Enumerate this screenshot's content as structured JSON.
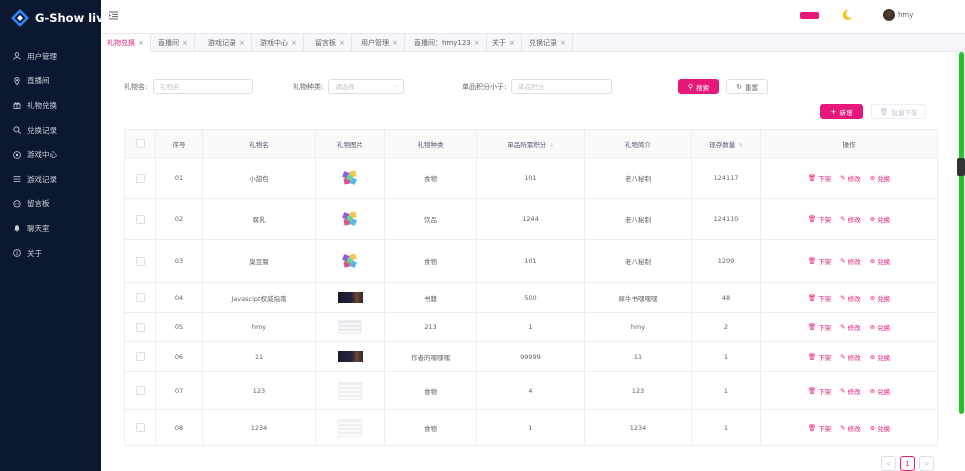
{
  "app": {
    "name": "G-Show live"
  },
  "sidebar": {
    "items": [
      {
        "label": "用户管理",
        "icon": "user-icon"
      },
      {
        "label": "直播间",
        "icon": "location-icon"
      },
      {
        "label": "礼物兑换",
        "icon": "gift-icon"
      },
      {
        "label": "兑换记录",
        "icon": "search-icon"
      },
      {
        "label": "游戏中心",
        "icon": "game-icon"
      },
      {
        "label": "游戏记录",
        "icon": "list-icon"
      },
      {
        "label": "留言板",
        "icon": "message-icon"
      },
      {
        "label": "聊天室",
        "icon": "bell-icon"
      },
      {
        "label": "关于",
        "icon": "info-icon"
      }
    ]
  },
  "header": {
    "user": "hmy",
    "accent": "#e6197a"
  },
  "tabs": [
    {
      "label": "礼物兑换",
      "active": true
    },
    {
      "label": "直播间"
    },
    {
      "label": "游戏记录"
    },
    {
      "label": "游戏中心"
    },
    {
      "label": "留言板"
    },
    {
      "label": "用户管理"
    },
    {
      "label": "直播间：hmy123"
    },
    {
      "label": "关于"
    },
    {
      "label": "兑换记录"
    }
  ],
  "search": {
    "gift_name_label": "礼物名:",
    "gift_name_placeholder": "礼物名",
    "gift_type_label": "礼物种类:",
    "gift_type_placeholder": "请选择",
    "points_label": "单品积分小于:",
    "points_placeholder": "单品积分",
    "search_btn": "搜索",
    "reset_btn": "重置"
  },
  "actions": {
    "add_btn": "新增",
    "batch_remove_btn": "批量下架"
  },
  "table": {
    "headers": {
      "index": "序号",
      "name": "礼物名",
      "image": "礼物图片",
      "type": "礼物种类",
      "points": "单品所需积分",
      "desc": "礼物简介",
      "stock": "现存数量",
      "ops": "操作"
    },
    "op_labels": {
      "remove": "下架",
      "edit": "修改",
      "exchange": "兑换"
    },
    "rows": [
      {
        "index": "01",
        "name": "小甜包",
        "image": "candy",
        "type": "食物",
        "points": "101",
        "desc": "老八秘制",
        "stock": "124117"
      },
      {
        "index": "02",
        "name": "腐乳",
        "image": "candy",
        "type": "饮品",
        "points": "1244",
        "desc": "老八秘制",
        "stock": "124110"
      },
      {
        "index": "03",
        "name": "臭豆腐",
        "image": "candy",
        "type": "食物",
        "points": "101",
        "desc": "老八秘制",
        "stock": "1209"
      },
      {
        "index": "04",
        "name": "Javascipt权威指南",
        "image": "dark",
        "type": "书籍",
        "points": "500",
        "desc": "犀牛书嘿嘿嘿",
        "stock": "48"
      },
      {
        "index": "05",
        "name": "hmy",
        "image": "doc",
        "type": "213",
        "points": "1",
        "desc": "hmy",
        "stock": "2"
      },
      {
        "index": "06",
        "name": "11",
        "image": "dark",
        "type": "作者的嘿嘿嘿",
        "points": "99999",
        "desc": "11",
        "stock": "1"
      },
      {
        "index": "07",
        "name": "123",
        "image": "sheet",
        "type": "食物",
        "points": "4",
        "desc": "123",
        "stock": "1"
      },
      {
        "index": "08",
        "name": "1234",
        "image": "sheet",
        "type": "食物",
        "points": "1",
        "desc": "1234",
        "stock": "1"
      }
    ]
  },
  "pagination": {
    "current": "1",
    "prev": "<",
    "next": ">"
  }
}
